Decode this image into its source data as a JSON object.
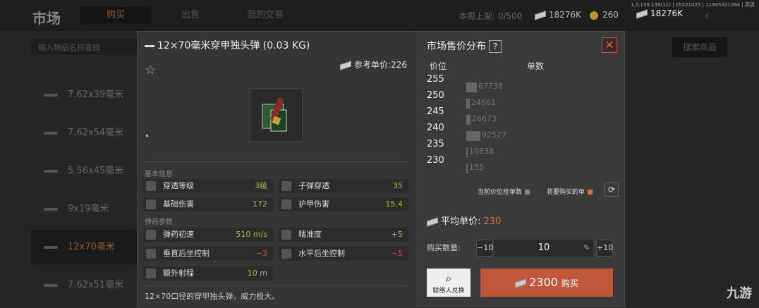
{
  "app": {
    "title": "市场",
    "tabs": [
      "购买",
      "出售",
      "我的交易"
    ],
    "version": "1.0.139.139(11) | 05221025 | 11945321394 | 高清",
    "listing_stat": "本周上架: 0/500",
    "money": "18276K",
    "coins": "260",
    "money2": "18276K",
    "search_placeholder": "输入物品名称查找",
    "search_btn": "搜索商品"
  },
  "categories": [
    "7.62x39毫米",
    "7.62x54毫米",
    "5.56x45毫米",
    "9x19毫米",
    "12x70毫米",
    "7.62x51毫米"
  ],
  "item": {
    "name": "12×70毫米穿甲独头弹 (0.03 KG)",
    "ref_label": "参考单价:226",
    "basic_title": "基本信息",
    "ammo_title": "弹药参数",
    "description": "12×70口径的穿甲独头弹，威力极大。",
    "stats": [
      {
        "label": "穿透等级",
        "value": "3级"
      },
      {
        "label": "子弹穿透",
        "value": "35"
      },
      {
        "label": "基础伤害",
        "value": "172"
      },
      {
        "label": "护甲伤害",
        "value": "15.4"
      },
      {
        "label": "弹药初速",
        "value": "510 m/s"
      },
      {
        "label": "精准度",
        "value": "+5"
      },
      {
        "label": "垂直后坐控制",
        "value": "−3"
      },
      {
        "label": "水平后坐控制",
        "value": "−5"
      },
      {
        "label": "额外射程",
        "value": "10 m"
      }
    ]
  },
  "market": {
    "title": "市场售价分布",
    "help": "?",
    "close": "✕",
    "col_price": "价位",
    "col_count": "单数",
    "rows": [
      {
        "price": "255",
        "count": "67738",
        "level": 0.73
      },
      {
        "price": "250",
        "count": "24861",
        "level": 0.27
      },
      {
        "price": "245",
        "count": "26673",
        "level": 0.29
      },
      {
        "price": "240",
        "count": "92527",
        "level": 1.0
      },
      {
        "price": "235",
        "count": "10838",
        "level": 0.12
      },
      {
        "price": "230",
        "count": "155",
        "level": 0.0
      }
    ],
    "legend1": "当前价位挂单数",
    "legend2": "将要购买的单",
    "avg_label": "平均单价:",
    "avg_value": "230",
    "qty_label": "购买数量:",
    "minus": "−10",
    "qty": "10",
    "plus": "+10",
    "contact": "联络人兑换",
    "buy_amount": "2300",
    "buy_label": "购买"
  },
  "watermark": "九游"
}
